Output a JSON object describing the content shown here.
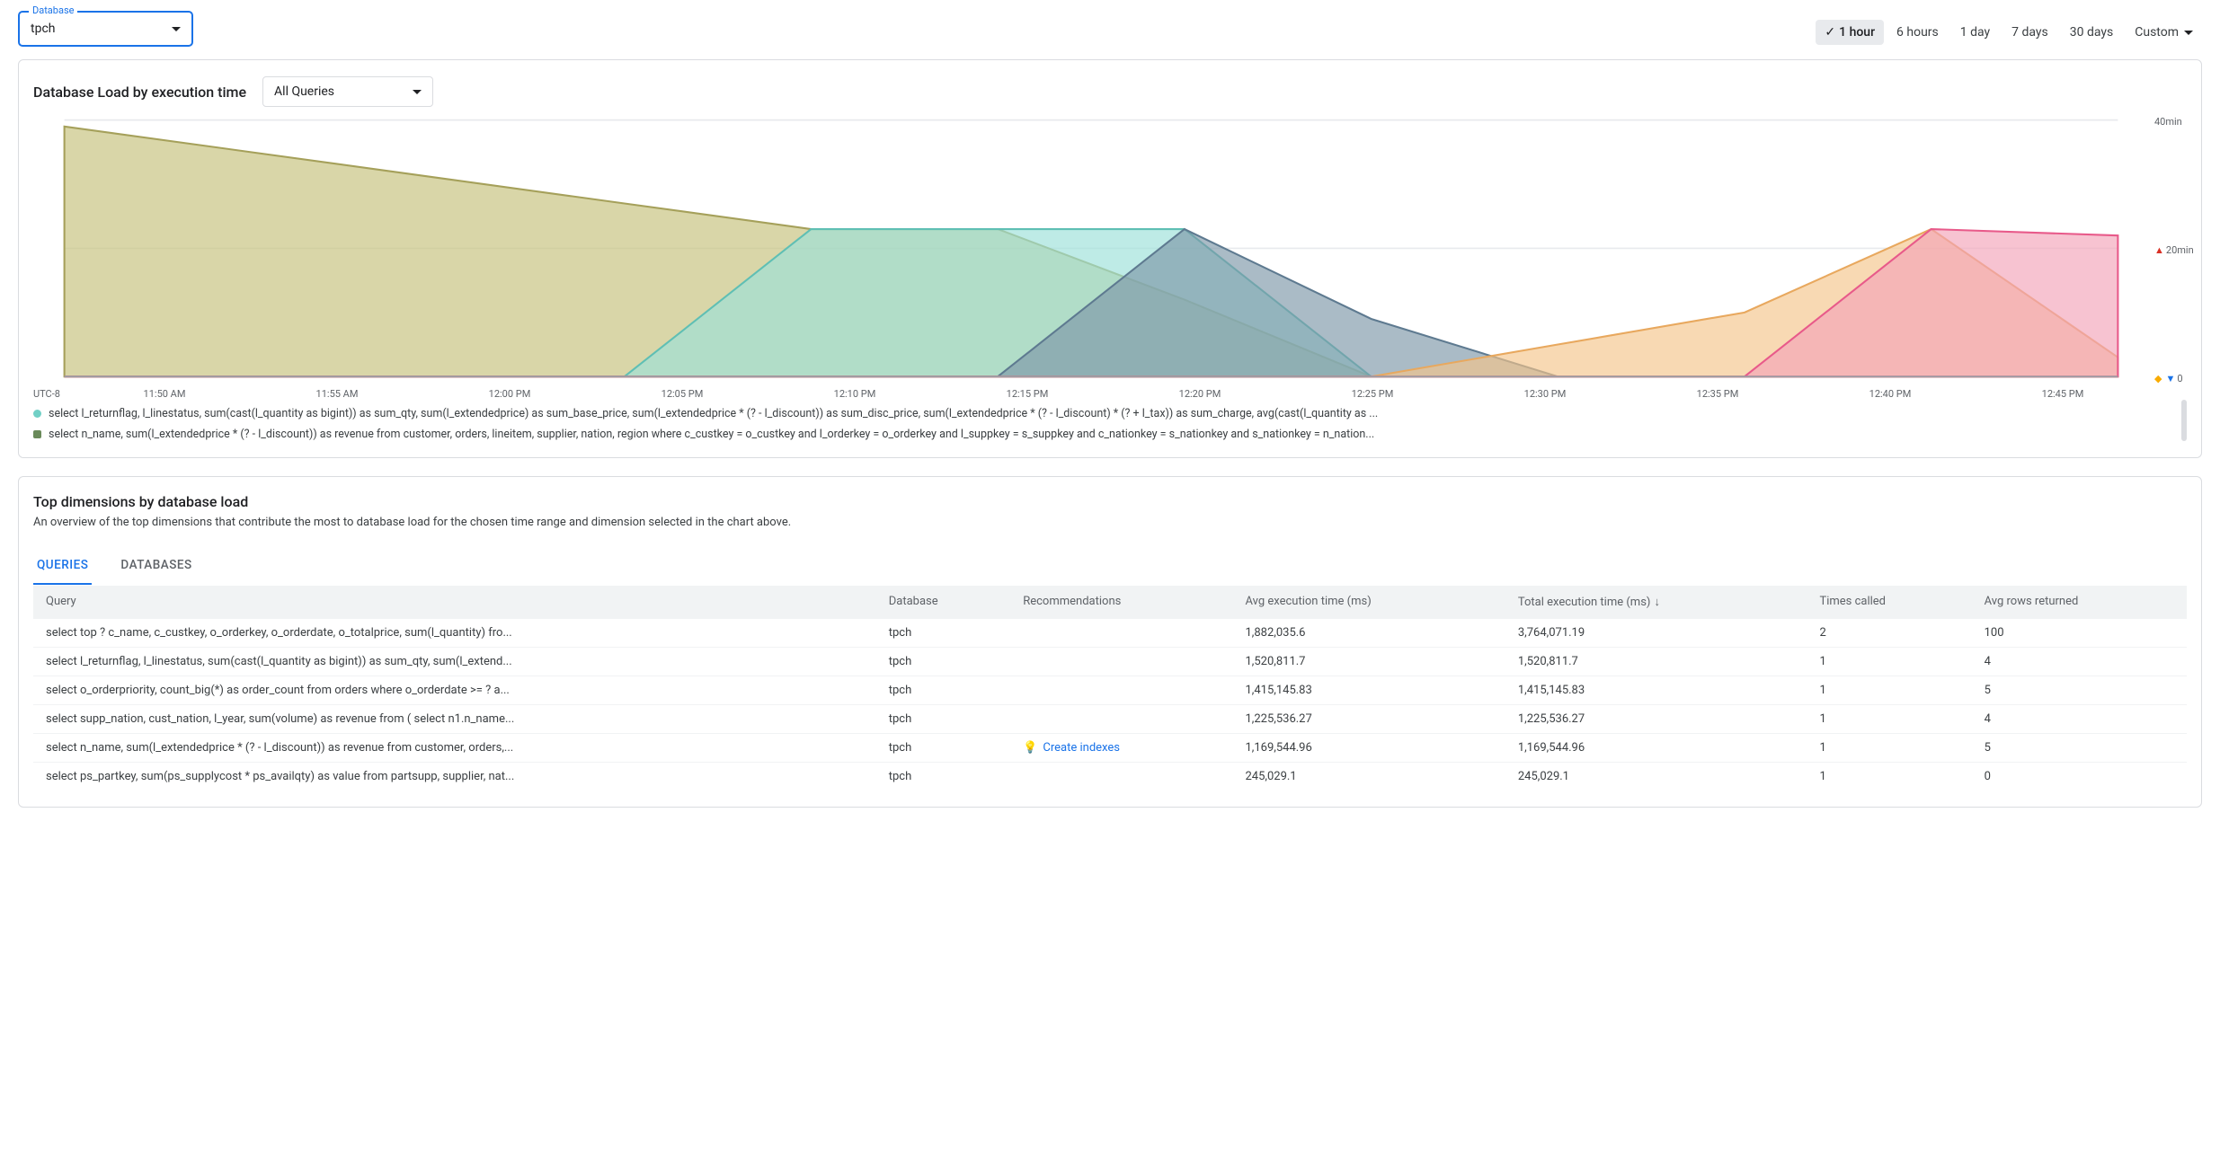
{
  "db_selector": {
    "label": "Database",
    "value": "tpch"
  },
  "time_ranges": [
    "1 hour",
    "6 hours",
    "1 day",
    "7 days",
    "30 days",
    "Custom"
  ],
  "time_active": "1 hour",
  "load_card": {
    "title": "Database Load by execution time",
    "filter": "All Queries",
    "legend": [
      {
        "color": "#71d0c6",
        "shape": "circle",
        "text": "select l_returnflag, l_linestatus, sum(cast(l_quantity as bigint)) as sum_qty, sum(l_extendedprice) as sum_base_price, sum(l_extendedprice * (? - l_discount)) as sum_disc_price, sum(l_extendedprice * (? - l_discount) * (? + l_tax)) as sum_charge, avg(cast(l_quantity as ..."
      },
      {
        "color": "#6a8a5a",
        "shape": "square",
        "text": "select n_name, sum(l_extendedprice * (? - l_discount)) as revenue from customer, orders, lineitem, supplier, nation, region where c_custkey = o_custkey and l_orderkey = o_orderkey and l_suppkey = s_suppkey and c_nationkey = s_nationkey and s_nationkey = n_nation..."
      }
    ]
  },
  "chart_data": {
    "type": "area",
    "timezone": "UTC-8",
    "x": [
      "11:50 AM",
      "11:55 AM",
      "12:00 PM",
      "12:05 PM",
      "12:10 PM",
      "12:15 PM",
      "12:20 PM",
      "12:25 PM",
      "12:30 PM",
      "12:35 PM",
      "12:40 PM",
      "12:45 PM"
    ],
    "ylim": [
      0,
      40
    ],
    "yunit": "min",
    "yticks": [
      0,
      20,
      40
    ],
    "series": [
      {
        "name": "olive",
        "color": "#c4c07a",
        "stroke": "#a5a05a",
        "values": [
          39,
          35,
          31,
          27,
          23,
          23,
          12,
          0,
          0,
          0,
          0,
          0
        ]
      },
      {
        "name": "teal",
        "color": "#9be1d8",
        "stroke": "#5fbfb4",
        "values": [
          0,
          0,
          0,
          0,
          23,
          23,
          23,
          0,
          0,
          0,
          0,
          0
        ]
      },
      {
        "name": "slate",
        "color": "#7d96a8",
        "stroke": "#5e7a90",
        "values": [
          0,
          0,
          0,
          0,
          0,
          0,
          23,
          9,
          0,
          0,
          0,
          0
        ]
      },
      {
        "name": "orange",
        "color": "#f5c48b",
        "stroke": "#e8a85e",
        "values": [
          0,
          0,
          0,
          0,
          0,
          0,
          0,
          0,
          5,
          10,
          23,
          3
        ]
      },
      {
        "name": "pink",
        "color": "#f3a3b8",
        "stroke": "#e85a8a",
        "values": [
          0,
          0,
          0,
          0,
          0,
          0,
          0,
          0,
          0,
          0,
          23,
          22
        ]
      }
    ]
  },
  "dim_card": {
    "title": "Top dimensions by database load",
    "subtitle": "An overview of the top dimensions that contribute the most to database load for the chosen time range and dimension selected in the chart above.",
    "tabs": [
      "QUERIES",
      "DATABASES"
    ],
    "tab_active": "QUERIES",
    "columns": [
      "Query",
      "Database",
      "Recommendations",
      "Avg execution time (ms)",
      "Total execution time (ms)",
      "Times called",
      "Avg rows returned"
    ],
    "sort_col": "Total execution time (ms)",
    "rows": [
      {
        "query": "select top ? c_name, c_custkey, o_orderkey, o_orderdate, o_totalprice, sum(l_quantity) fro...",
        "db": "tpch",
        "rec": "",
        "avg": "1,882,035.6",
        "total": "3,764,071.19",
        "times": "2",
        "rows": "100"
      },
      {
        "query": "select l_returnflag, l_linestatus, sum(cast(l_quantity as bigint)) as sum_qty, sum(l_extend...",
        "db": "tpch",
        "rec": "",
        "avg": "1,520,811.7",
        "total": "1,520,811.7",
        "times": "1",
        "rows": "4"
      },
      {
        "query": "select o_orderpriority, count_big(*) as order_count from orders where o_orderdate >= ? a...",
        "db": "tpch",
        "rec": "",
        "avg": "1,415,145.83",
        "total": "1,415,145.83",
        "times": "1",
        "rows": "5"
      },
      {
        "query": "select supp_nation, cust_nation, l_year, sum(volume) as revenue from ( select n1.n_name...",
        "db": "tpch",
        "rec": "",
        "avg": "1,225,536.27",
        "total": "1,225,536.27",
        "times": "1",
        "rows": "4"
      },
      {
        "query": "select n_name, sum(l_extendedprice * (? - l_discount)) as revenue from customer, orders,...",
        "db": "tpch",
        "rec": "Create indexes",
        "avg": "1,169,544.96",
        "total": "1,169,544.96",
        "times": "1",
        "rows": "5"
      },
      {
        "query": "select ps_partkey, sum(ps_supplycost * ps_availqty) as value from partsupp, supplier, nat...",
        "db": "tpch",
        "rec": "",
        "avg": "245,029.1",
        "total": "245,029.1",
        "times": "1",
        "rows": "0"
      }
    ]
  }
}
